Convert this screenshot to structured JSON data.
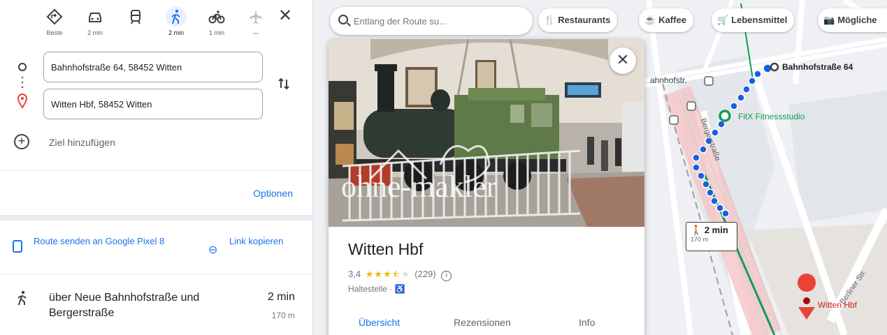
{
  "travel_modes": [
    {
      "name": "best",
      "label": "Beste",
      "glyph": "⬦"
    },
    {
      "name": "car",
      "label": "2 min",
      "glyph": "🚗"
    },
    {
      "name": "transit",
      "label": "",
      "glyph": "🚆"
    },
    {
      "name": "walk",
      "label": "2 min",
      "glyph": "🚶"
    },
    {
      "name": "bike",
      "label": "1 min",
      "glyph": "🚲"
    },
    {
      "name": "flight",
      "label": "—",
      "glyph": "✈"
    }
  ],
  "directions": {
    "origin": "Bahnhofstraße 64, 58452 Witten",
    "destination": "Witten Hbf, 58452 Witten",
    "add_destination": "Ziel hinzufügen",
    "options": "Optionen",
    "send_to_device": "Route senden an Google Pixel 8",
    "copy_link": "Link kopieren",
    "route": {
      "description": "über Neue Bahnhofstraße und Bergerstraße",
      "time": "2 min",
      "distance": "170 m"
    }
  },
  "search": {
    "placeholder": "Entlang der Route su..."
  },
  "chips": [
    {
      "icon": "🍴",
      "label": "Restaurants"
    },
    {
      "icon": "☕",
      "label": "Kaffee"
    },
    {
      "icon": "🛒",
      "label": "Lebensmittel"
    },
    {
      "icon": "📷",
      "label": "Mögliche"
    }
  ],
  "place": {
    "name": "Witten Hbf",
    "rating": "3,4",
    "stars": 3.4,
    "reviews": "(229)",
    "type": "Haltestelle · ",
    "watermark": "ohne-makler",
    "tabs": [
      "Übersicht",
      "Rezensionen",
      "Info"
    ]
  },
  "map": {
    "origin_label": "Bahnhofstraße 64",
    "poi_label": "FitX Fitnessstudio",
    "destination_label": "Witten Hbf",
    "street_top": "ahnhofstr.",
    "street_berger": "Bergerstraße",
    "street_berliner": "Berliner Str.",
    "walk_time": "2 min",
    "walk_dist": "170 m"
  },
  "colors": {
    "accent": "#1a73e8",
    "route_dots": "#1a5fe0",
    "rail_green": "#0f9d58",
    "pin_red": "#ea4335",
    "poi_green": "#0f9d58"
  }
}
